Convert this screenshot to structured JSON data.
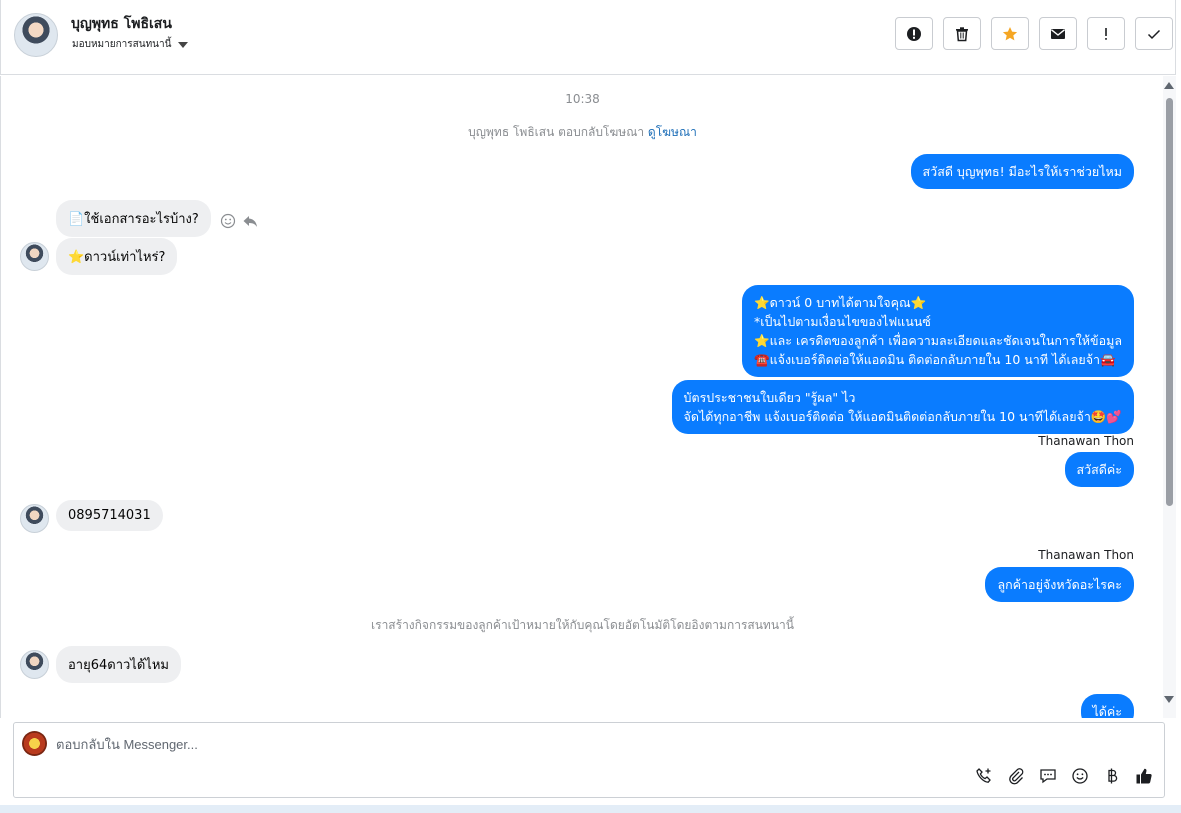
{
  "header": {
    "contact_name": "บุญพุทธ โพธิเสน",
    "assign_label": "มอบหมายการสนทนานี้"
  },
  "conversation": {
    "timestamp": "10:38",
    "ad_reply_text": "บุญพุทธ โพธิเสน ตอบกลับโฆษณา",
    "ad_link": "ดูโฆษณา",
    "activity_note": "เราสร้างกิจกรรมของลูกค้าเป้าหมายให้กับคุณโดยอัตโนมัติโดยอิงตามการสนทนานี้",
    "messages": [
      {
        "dir": "out",
        "lines": [
          "สวัสดี บุญพุทธ! มีอะไรให้เราช่วยไหม"
        ]
      },
      {
        "dir": "in",
        "lines": [
          "📄ใช้เอกสารอะไรบ้าง?"
        ]
      },
      {
        "dir": "in",
        "lines": [
          "⭐ดาวน์เท่าไหร่?"
        ]
      },
      {
        "dir": "out",
        "lines": [
          "⭐ดาวน์ 0 บาทได้ตามใจคุณ⭐",
          "*เป็นไปตามเงื่อนไขของไฟแนนซ์",
          "⭐และ เครดิตของลูกค้า เพื่อความละเอียดและชัดเจนในการให้ข้อมูล",
          "☎️แจ้งเบอร์ติดต่อให้แอดมิน ติดต่อกลับภายใน 10 นาที ได้เลยจ้า🚘"
        ]
      },
      {
        "dir": "out",
        "lines": [
          "บัตรประชาชนใบเดียว \"รู้ผล\" ไว",
          "จัดได้ทุกอาชีพ แจ้งเบอร์ติดต่อ ให้แอดมินติดต่อกลับภายใน 10 นาทีได้เลยจ้า🤩💕"
        ]
      },
      {
        "dir": "out",
        "sender": "Thanawan Thon",
        "lines": [
          "สวัสดีค่ะ"
        ]
      },
      {
        "dir": "in",
        "lines": [
          "0895714031"
        ]
      },
      {
        "dir": "out",
        "sender": "Thanawan Thon",
        "lines": [
          "ลูกค้าอยู่จังหวัดอะไรคะ"
        ]
      },
      {
        "dir": "in",
        "lines": [
          "อายุ64ดาวได้ไหม"
        ]
      },
      {
        "dir": "out",
        "lines": [
          "ได้ค่ะ"
        ]
      }
    ]
  },
  "composer": {
    "placeholder": "ตอบกลับใน Messenger..."
  },
  "colors": {
    "outgoing_bubble": "#0a7cff",
    "incoming_bubble": "#eeeff1",
    "star_accent": "#f5a623"
  }
}
